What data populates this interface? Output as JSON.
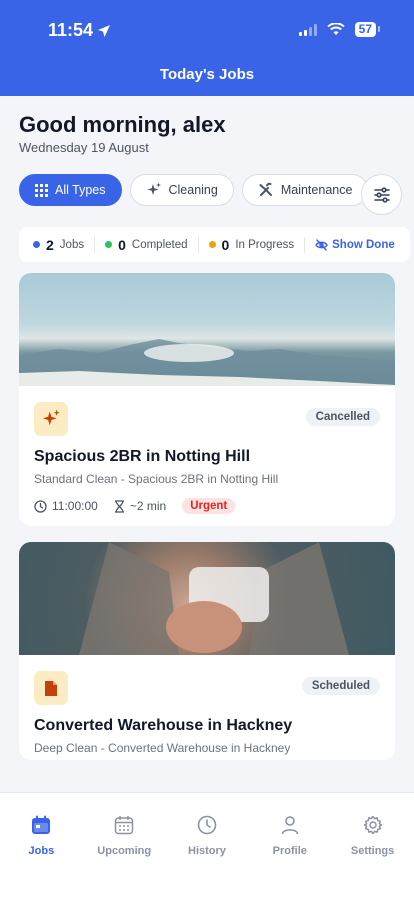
{
  "status_bar": {
    "time": "11:54",
    "battery": "57"
  },
  "header": {
    "title": "Today's Jobs"
  },
  "greeting": "Good morning, alex",
  "date": "Wednesday 19 August",
  "filters": [
    {
      "label": "All Types",
      "icon": "grid-icon",
      "active": true
    },
    {
      "label": "Cleaning",
      "icon": "sparkles-icon",
      "active": false
    },
    {
      "label": "Maintenance",
      "icon": "tools-icon",
      "active": false
    }
  ],
  "stats": {
    "jobs": {
      "count": "2",
      "label": "Jobs",
      "color": "#3a64e8"
    },
    "completed": {
      "count": "0",
      "label": "Completed",
      "color": "#22c55e"
    },
    "in_progress": {
      "count": "0",
      "label": "In Progress",
      "color": "#f59e0b"
    },
    "show_done": "Show Done"
  },
  "jobs": [
    {
      "title": "Spacious 2BR in Notting Hill",
      "subtitle": "Standard Clean - Spacious 2BR in Notting Hill",
      "status": "Cancelled",
      "icon": "sparkles-icon",
      "time": "11:00:00",
      "duration": "~2 min",
      "priority": "Urgent"
    },
    {
      "title": "Converted Warehouse in Hackney",
      "subtitle": "Deep Clean - Converted Warehouse in Hackney",
      "status": "Scheduled",
      "icon": "document-icon"
    }
  ],
  "tabs": [
    {
      "label": "Jobs",
      "icon": "calendar-today-icon",
      "active": true
    },
    {
      "label": "Upcoming",
      "icon": "calendar-icon",
      "active": false
    },
    {
      "label": "History",
      "icon": "clock-icon",
      "active": false
    },
    {
      "label": "Profile",
      "icon": "person-icon",
      "active": false
    },
    {
      "label": "Settings",
      "icon": "gear-icon",
      "active": false
    }
  ],
  "colors": {
    "primary": "#3a64e8",
    "urgent": "#dc2626",
    "icon_bg": "#fbecc3",
    "icon_fg": "#c2410c"
  }
}
